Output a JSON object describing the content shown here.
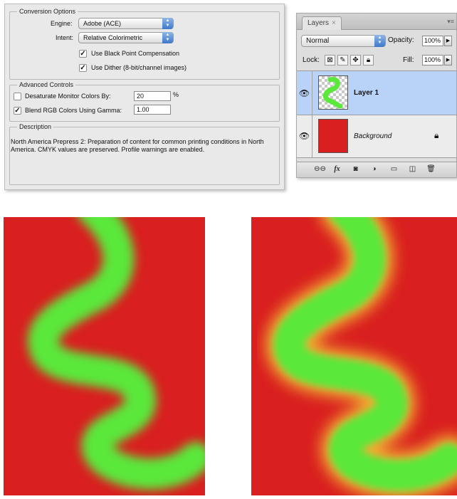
{
  "dialog": {
    "conversion_title": "Conversion Options",
    "engine_label": "Engine:",
    "engine_value": "Adobe (ACE)",
    "intent_label": "Intent:",
    "intent_value": "Relative Colorimetric",
    "bpc_label": "Use Black Point Compensation",
    "bpc_checked": true,
    "dither_label": "Use Dither (8-bit/channel images)",
    "dither_checked": true,
    "advanced_title": "Advanced Controls",
    "desaturate_label": "Desaturate Monitor Colors By:",
    "desaturate_checked": false,
    "desaturate_value": "20",
    "desaturate_unit": "%",
    "blend_label": "Blend RGB Colors Using Gamma:",
    "blend_checked": true,
    "blend_value": "1.00",
    "description_title": "Description",
    "description_text": "North America Prepress 2:  Preparation of content for common printing conditions in North America. CMYK values are preserved. Profile warnings are enabled."
  },
  "layers_panel": {
    "tab_label": "Layers",
    "tab_close": "×",
    "blend_mode": "Normal",
    "opacity_label": "Opacity:",
    "opacity_value": "100%",
    "lock_label": "Lock:",
    "fill_label": "Fill:",
    "fill_value": "100%",
    "layers": [
      {
        "name": "Layer 1",
        "selected": true,
        "visible": true
      },
      {
        "name": "Background",
        "selected": false,
        "visible": true,
        "locked": true
      }
    ],
    "bottom_icons": [
      "link-icon",
      "fx-icon",
      "mask-icon",
      "adjustment-icon",
      "group-icon",
      "new-layer-icon",
      "trash-icon"
    ]
  },
  "colors": {
    "red": "#d91f1f",
    "green": "#5ae83a",
    "orange_halo": "#f0b030",
    "selection_blue": "#b9d2f7"
  }
}
